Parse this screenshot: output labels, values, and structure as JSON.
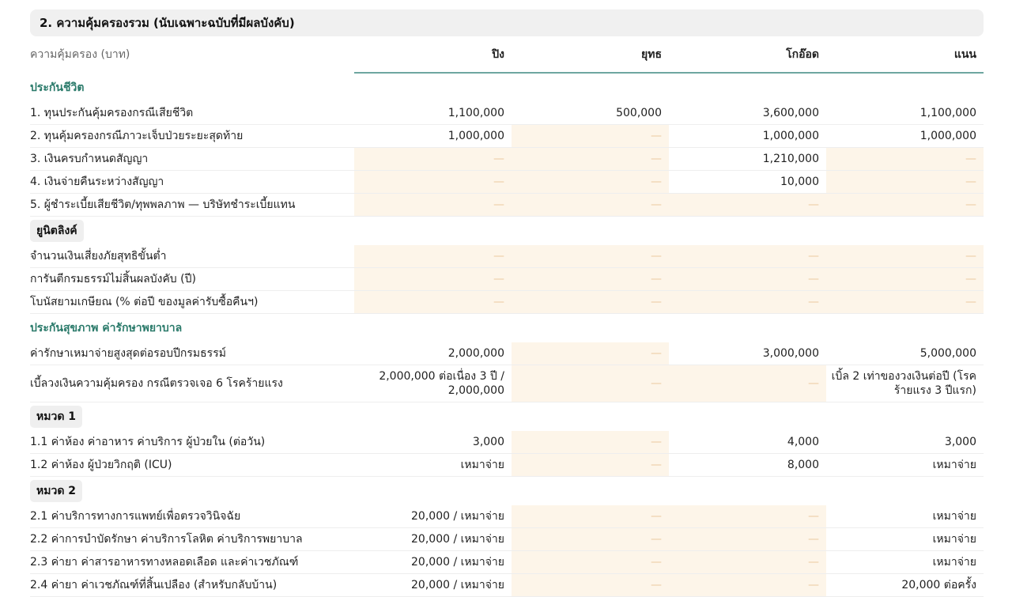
{
  "section_title": "2. ความคุ้มครองรวม (นับเฉพาะฉบับที่มีผลบังคับ)",
  "table": {
    "label_header": "ความคุ้มครอง (บาท)",
    "plans": [
      "ปิง",
      "ยุทธ",
      "โกอ๊อด",
      "แนน"
    ]
  },
  "na_symbol": "—",
  "groups": [
    {
      "title": "ประกันชีวิต",
      "style": "category",
      "rows": [
        {
          "label": "1. ทุนประกันคุ้มครองกรณีเสียชีวิต",
          "values": [
            "1,100,000",
            "500,000",
            "3,600,000",
            "1,100,000"
          ]
        },
        {
          "label": "2. ทุนคุ้มครองกรณีภาวะเจ็บป่วยระยะสุดท้าย",
          "values": [
            "1,000,000",
            null,
            "1,000,000",
            "1,000,000"
          ]
        },
        {
          "label": "3. เงินครบกำหนดสัญญา",
          "values": [
            null,
            null,
            "1,210,000",
            null
          ]
        },
        {
          "label": "4. เงินจ่ายคืนระหว่างสัญญา",
          "values": [
            null,
            null,
            "10,000",
            null
          ]
        },
        {
          "label": "5. ผู้ชำระเบี้ยเสียชีวิต/ทุพพลภาพ — บริษัทชำระเบี้ยแทน",
          "values": [
            null,
            null,
            null,
            null
          ]
        }
      ]
    },
    {
      "title": "ยูนิตลิงค์",
      "style": "pill",
      "rows": [
        {
          "label": "จำนวนเงินเสี่ยงภัยสุทธิขั้นต่ำ",
          "values": [
            null,
            null,
            null,
            null
          ]
        },
        {
          "label": "การันตีกรมธรรม์ไม่สิ้นผลบังคับ (ปี)",
          "values": [
            null,
            null,
            null,
            null
          ]
        },
        {
          "label": "โบนัสยามเกษียณ (% ต่อปี ของมูลค่ารับซื้อคืนฯ)",
          "values": [
            null,
            null,
            null,
            null
          ]
        }
      ]
    },
    {
      "title": "ประกันสุขภาพ ค่ารักษาพยาบาล",
      "style": "category",
      "rows": [
        {
          "label": "ค่ารักษาเหมาจ่ายสูงสุดต่อรอบปีกรมธรรม์",
          "values": [
            "2,000,000",
            null,
            "3,000,000",
            "5,000,000"
          ]
        },
        {
          "label": "เบี้ลวงเงินความคุ้มครอง กรณีตรวจเจอ 6 โรคร้ายแรง",
          "values": [
            "2,000,000 ต่อเนื่อง 3 ปี / 2,000,000",
            null,
            null,
            "เบิ้ล 2 เท่าของวงเงินต่อปี (โรคร้ายแรง 3 ปีแรก)"
          ],
          "tall": true
        }
      ]
    },
    {
      "title": "หมวด 1",
      "style": "pill",
      "rows": [
        {
          "label": "1.1 ค่าห้อง ค่าอาหาร ค่าบริการ ผู้ป่วยใน (ต่อวัน)",
          "values": [
            "3,000",
            null,
            "4,000",
            "3,000"
          ]
        },
        {
          "label": "1.2 ค่าห้อง ผู้ป่วยวิกฤติ (ICU)",
          "values": [
            "เหมาจ่าย",
            null,
            "8,000",
            "เหมาจ่าย"
          ]
        }
      ]
    },
    {
      "title": "หมวด 2",
      "style": "pill",
      "rows": [
        {
          "label": "2.1 ค่าบริการทางการแพทย์เพื่อตรวจวินิจฉัย",
          "values": [
            "20,000 / เหมาจ่าย",
            null,
            null,
            "เหมาจ่าย"
          ]
        },
        {
          "label": "2.2 ค่าการบำบัดรักษา ค่าบริการโลหิต ค่าบริการพยาบาล",
          "values": [
            "20,000 / เหมาจ่าย",
            null,
            null,
            "เหมาจ่าย"
          ]
        },
        {
          "label": "2.3 ค่ายา ค่าสารอาหารทางหลอดเลือด และค่าเวชภัณฑ์",
          "values": [
            "20,000 / เหมาจ่าย",
            null,
            null,
            "เหมาจ่าย"
          ]
        },
        {
          "label": "2.4 ค่ายา ค่าเวชภัณฑ์ที่สิ้นเปลือง (สำหรับกลับบ้าน)",
          "values": [
            "20,000 / เหมาจ่าย",
            null,
            null,
            "20,000 ต่อครั้ง"
          ]
        }
      ]
    }
  ]
}
